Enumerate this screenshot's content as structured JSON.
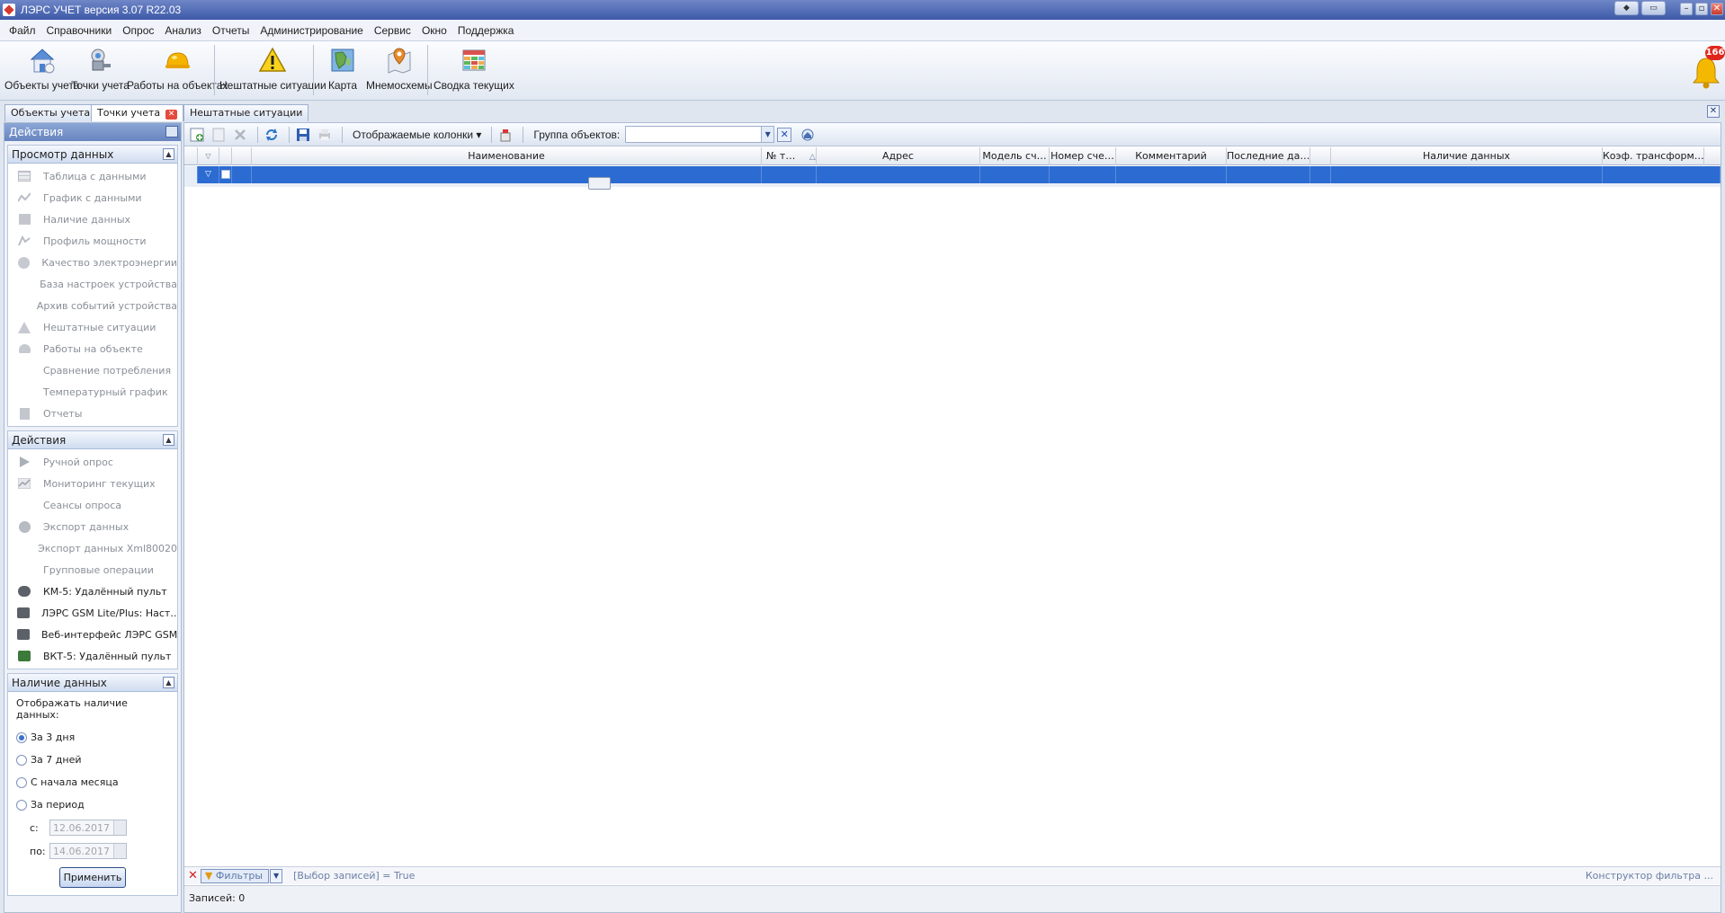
{
  "window": {
    "title": "ЛЭРС УЧЕТ версия 3.07 R22.03"
  },
  "menu": [
    "Файл",
    "Справочники",
    "Опрос",
    "Анализ",
    "Отчеты",
    "Администрирование",
    "Сервис",
    "Окно",
    "Поддержка"
  ],
  "ribbon": {
    "buttons": [
      "Объекты учета",
      "Точки учета",
      "Работы на объектах",
      "Нештатные ситуации",
      "Карта",
      "Мнемосхемы",
      "Сводка текущих"
    ],
    "notifications_count": "166"
  },
  "doc_tabs": [
    {
      "label": "Объекты учета"
    },
    {
      "label": "Точки учета"
    },
    {
      "label": "Нештатные ситуации"
    }
  ],
  "left_panel": {
    "header": "Действия",
    "view_group": {
      "title": "Просмотр данных",
      "items": [
        "Таблица с данными",
        "График с данными",
        "Наличие данных",
        "Профиль мощности",
        "Качество электроэнергии",
        "База настроек устройства",
        "Архив событий устройства",
        "Нештатные ситуации",
        "Работы на объекте",
        "Сравнение потребления",
        "Температурный график",
        "Отчеты"
      ]
    },
    "actions_group": {
      "title": "Действия",
      "items": [
        "Ручной опрос",
        "Мониторинг текущих",
        "Сеансы опроса",
        "Экспорт данных",
        "Экспорт данных Xml80020",
        "Групповые операции",
        "КМ-5: Удалённый пульт",
        "ЛЭРС GSM Lite/Plus: Наст…",
        "Веб-интерфейс ЛЭРС GSM",
        "ВКТ-5: Удалённый пульт"
      ]
    },
    "data_group": {
      "title": "Наличие данных",
      "caption": "Отображать наличие данных:",
      "options": [
        "За 3 дня",
        "За 7 дней",
        "С начала месяца",
        "За период"
      ],
      "selected_option": "За 3 дня",
      "from_label": "с:",
      "from_value": "12.06.2017",
      "to_label": "по:",
      "to_value": "14.06.2017",
      "apply_label": "Применить"
    }
  },
  "grid_toolbar": {
    "columns_label": "Отображаемые колонки",
    "group_label": "Группа объектов:",
    "group_value": ""
  },
  "grid": {
    "columns": [
      "Наименование",
      "№ т…",
      "Адрес",
      "Модель сч…",
      "Номер сче…",
      "Комментарий",
      "Последние да…",
      "Наличие данных",
      "Коэф. трансформ…"
    ]
  },
  "filter_bar": {
    "filters_label": "Фильтры",
    "expression": "[Выбор записей] = True",
    "constructor_label": "Конструктор фильтра ..."
  },
  "status": {
    "records": "Записей: 0"
  },
  "colors": {
    "title_bar": "#3d5aa8",
    "selected_row": "#2c6bd1",
    "panel_header": "#6885bf",
    "badge": "#e0261c"
  },
  "icons": [
    "app-icon",
    "house-icon",
    "meter-icon",
    "helmet-icon",
    "warning-icon",
    "map-icon",
    "pin-map-icon",
    "table-grid-icon",
    "bell-icon"
  ]
}
